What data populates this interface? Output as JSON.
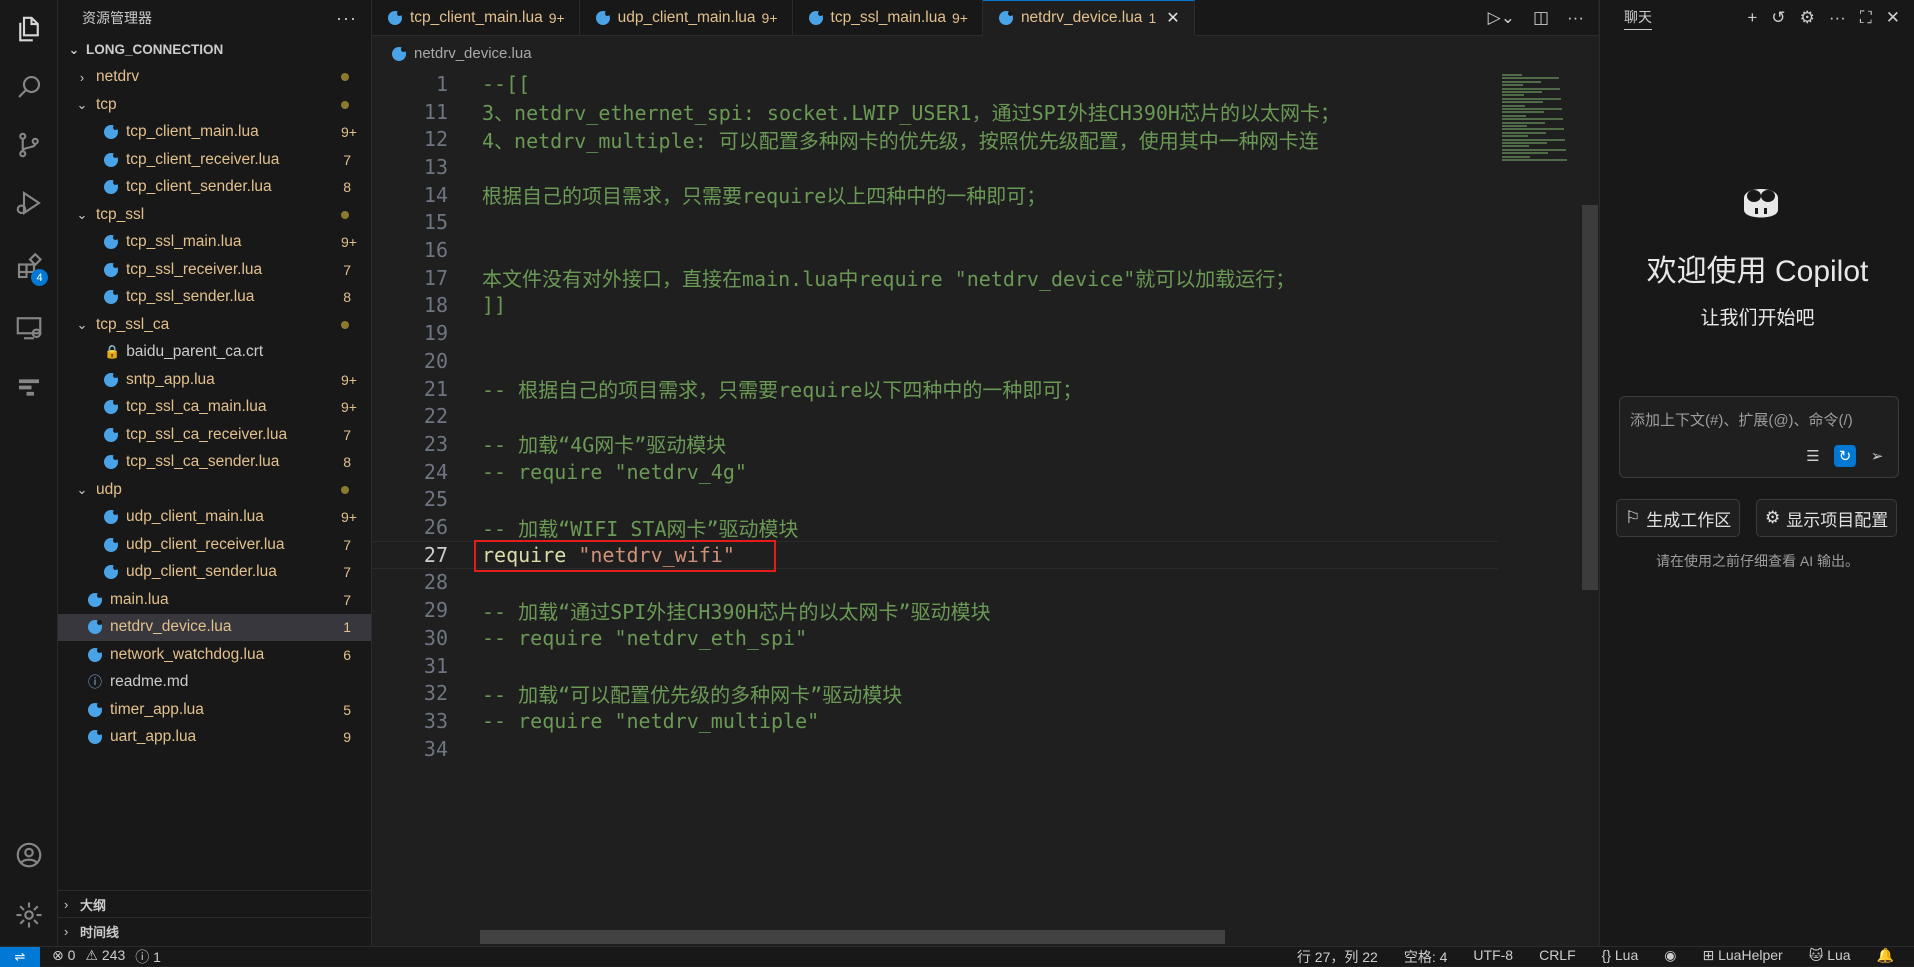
{
  "sidebar": {
    "title": "资源管理器",
    "root": "LONG_CONNECTION",
    "items": [
      {
        "label": "netdrv",
        "type": "folder",
        "open": false,
        "depth": 1,
        "badge": ""
      },
      {
        "label": "tcp",
        "type": "folder",
        "open": true,
        "depth": 1,
        "badge": ""
      },
      {
        "label": "tcp_client_main.lua",
        "type": "lua",
        "depth": 2,
        "badge": "9+"
      },
      {
        "label": "tcp_client_receiver.lua",
        "type": "lua",
        "depth": 2,
        "badge": "7"
      },
      {
        "label": "tcp_client_sender.lua",
        "type": "lua",
        "depth": 2,
        "badge": "8"
      },
      {
        "label": "tcp_ssl",
        "type": "folder",
        "open": true,
        "depth": 1,
        "badge": ""
      },
      {
        "label": "tcp_ssl_main.lua",
        "type": "lua",
        "depth": 2,
        "badge": "9+"
      },
      {
        "label": "tcp_ssl_receiver.lua",
        "type": "lua",
        "depth": 2,
        "badge": "7"
      },
      {
        "label": "tcp_ssl_sender.lua",
        "type": "lua",
        "depth": 2,
        "badge": "8"
      },
      {
        "label": "tcp_ssl_ca",
        "type": "folder",
        "open": true,
        "depth": 1,
        "badge": ""
      },
      {
        "label": "baidu_parent_ca.crt",
        "type": "cert",
        "depth": 2,
        "badge": ""
      },
      {
        "label": "sntp_app.lua",
        "type": "lua",
        "depth": 2,
        "badge": "9+"
      },
      {
        "label": "tcp_ssl_ca_main.lua",
        "type": "lua",
        "depth": 2,
        "badge": "9+"
      },
      {
        "label": "tcp_ssl_ca_receiver.lua",
        "type": "lua",
        "depth": 2,
        "badge": "7"
      },
      {
        "label": "tcp_ssl_ca_sender.lua",
        "type": "lua",
        "depth": 2,
        "badge": "8"
      },
      {
        "label": "udp",
        "type": "folder",
        "open": true,
        "depth": 1,
        "badge": ""
      },
      {
        "label": "udp_client_main.lua",
        "type": "lua",
        "depth": 2,
        "badge": "9+"
      },
      {
        "label": "udp_client_receiver.lua",
        "type": "lua",
        "depth": 2,
        "badge": "7"
      },
      {
        "label": "udp_client_sender.lua",
        "type": "lua",
        "depth": 2,
        "badge": "7"
      },
      {
        "label": "main.lua",
        "type": "lua",
        "depth": 1,
        "badge": "7"
      },
      {
        "label": "netdrv_device.lua",
        "type": "lua",
        "depth": 1,
        "badge": "1",
        "selected": true
      },
      {
        "label": "network_watchdog.lua",
        "type": "lua",
        "depth": 1,
        "badge": "6"
      },
      {
        "label": "readme.md",
        "type": "info",
        "depth": 1,
        "badge": ""
      },
      {
        "label": "timer_app.lua",
        "type": "lua",
        "depth": 1,
        "badge": "5"
      },
      {
        "label": "uart_app.lua",
        "type": "lua",
        "depth": 1,
        "badge": "9"
      }
    ],
    "outline_label": "大纲",
    "timeline_label": "时间线"
  },
  "tabs": [
    {
      "label": "tcp_client_main.lua",
      "count": "9+"
    },
    {
      "label": "udp_client_main.lua",
      "count": "9+"
    },
    {
      "label": "tcp_ssl_main.lua",
      "count": "9+"
    },
    {
      "label": "netdrv_device.lua",
      "count": "1",
      "active": true
    }
  ],
  "breadcrumb": "netdrv_device.lua",
  "editor": {
    "lines": [
      {
        "n": "1",
        "parts": [
          [
            "cmt",
            "--[["
          ]
        ]
      },
      {
        "n": "11",
        "parts": [
          [
            "cmt",
            "3、netdrv_ethernet_spi: socket.LWIP_USER1，通过SPI外挂CH390H芯片的以太网卡；"
          ]
        ]
      },
      {
        "n": "12",
        "parts": [
          [
            "cmt",
            "4、netdrv_multiple: 可以配置多种网卡的优先级，按照优先级配置，使用其中一种网卡连"
          ]
        ]
      },
      {
        "n": "13",
        "parts": []
      },
      {
        "n": "14",
        "parts": [
          [
            "cmt",
            "根据自己的项目需求，只需要require以上四种中的一种即可；"
          ]
        ]
      },
      {
        "n": "15",
        "parts": []
      },
      {
        "n": "16",
        "parts": []
      },
      {
        "n": "17",
        "parts": [
          [
            "cmt",
            "本文件没有对外接口，直接在main.lua中require \"netdrv_device\"就可以加载运行；"
          ]
        ]
      },
      {
        "n": "18",
        "parts": [
          [
            "cmt",
            "]]"
          ]
        ]
      },
      {
        "n": "19",
        "parts": []
      },
      {
        "n": "20",
        "parts": []
      },
      {
        "n": "21",
        "parts": [
          [
            "cmt",
            "-- 根据自己的项目需求，只需要require以下四种中的一种即可；"
          ]
        ]
      },
      {
        "n": "22",
        "parts": []
      },
      {
        "n": "23",
        "parts": [
          [
            "cmt",
            "-- 加载“4G网卡”驱动模块"
          ]
        ]
      },
      {
        "n": "24",
        "parts": [
          [
            "cmt",
            "-- require \"netdrv_4g\""
          ]
        ]
      },
      {
        "n": "25",
        "parts": []
      },
      {
        "n": "26",
        "parts": [
          [
            "cmt",
            "-- 加载“WIFI STA网卡”驱动模块"
          ]
        ]
      },
      {
        "n": "27",
        "parts": [
          [
            "kw",
            "require "
          ],
          [
            "str",
            "\"netdrv_wifi\""
          ]
        ],
        "current": true
      },
      {
        "n": "28",
        "parts": []
      },
      {
        "n": "29",
        "parts": [
          [
            "cmt",
            "-- 加载“通过SPI外挂CH390H芯片的以太网卡”驱动模块"
          ]
        ]
      },
      {
        "n": "30",
        "parts": [
          [
            "cmt",
            "-- require \"netdrv_eth_spi\""
          ]
        ]
      },
      {
        "n": "31",
        "parts": []
      },
      {
        "n": "32",
        "parts": [
          [
            "cmt",
            "-- 加载“可以配置优先级的多种网卡”驱动模块"
          ]
        ]
      },
      {
        "n": "33",
        "parts": [
          [
            "cmt",
            "-- require \"netdrv_multiple\""
          ]
        ]
      },
      {
        "n": "34",
        "parts": []
      }
    ]
  },
  "copilot": {
    "tab_label": "聊天",
    "title": "欢迎使用 Copilot",
    "subtitle": "让我们开始吧",
    "input_placeholder": "添加上下文(#)、扩展(@)、命令(/)",
    "btn_workspace": "生成工作区",
    "btn_config": "显示项目配置",
    "note": "请在使用之前仔细查看 AI 输出。"
  },
  "status": {
    "errors": "0",
    "warnings": "243",
    "info": "1",
    "position": "行 27，列 22",
    "spaces": "空格: 4",
    "encoding": "UTF-8",
    "eol": "CRLF",
    "language": "Lua",
    "helper": "LuaHelper",
    "lang2": "Lua"
  }
}
